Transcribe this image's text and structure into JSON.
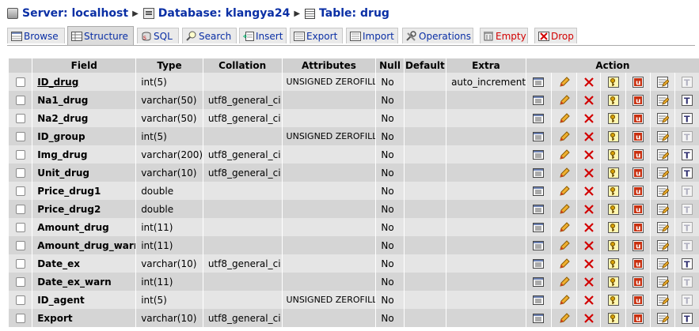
{
  "breadcrumb": {
    "server": "Server: localhost",
    "database": "Database: klangya24",
    "table": "Table: drug"
  },
  "tabs": [
    {
      "label": "Browse",
      "icon": "browse-icon"
    },
    {
      "label": "Structure",
      "icon": "structure-icon"
    },
    {
      "label": "SQL",
      "icon": "sql-icon"
    },
    {
      "label": "Search",
      "icon": "search-icon"
    },
    {
      "label": "Insert",
      "icon": "insert-icon"
    },
    {
      "label": "Export",
      "icon": "export-icon"
    },
    {
      "label": "Import",
      "icon": "import-icon"
    },
    {
      "label": "Operations",
      "icon": "operations-icon"
    },
    {
      "label": "Empty",
      "icon": "empty-icon"
    },
    {
      "label": "Drop",
      "icon": "drop-icon"
    }
  ],
  "active_tab": "Structure",
  "columns": {
    "field": "Field",
    "type": "Type",
    "collation": "Collation",
    "attributes": "Attributes",
    "null": "Null",
    "default": "Default",
    "extra": "Extra",
    "action": "Action"
  },
  "rows": [
    {
      "field": "ID_drug",
      "type": "int(5)",
      "collation": "",
      "attributes": "UNSIGNED ZEROFILL",
      "null": "No",
      "default": "",
      "extra": "auto_increment"
    },
    {
      "field": "Na1_drug",
      "type": "varchar(50)",
      "collation": "utf8_general_ci",
      "attributes": "",
      "null": "No",
      "default": "",
      "extra": ""
    },
    {
      "field": "Na2_drug",
      "type": "varchar(50)",
      "collation": "utf8_general_ci",
      "attributes": "",
      "null": "No",
      "default": "",
      "extra": ""
    },
    {
      "field": "ID_group",
      "type": "int(5)",
      "collation": "",
      "attributes": "UNSIGNED ZEROFILL",
      "null": "No",
      "default": "",
      "extra": ""
    },
    {
      "field": "Img_drug",
      "type": "varchar(200)",
      "collation": "utf8_general_ci",
      "attributes": "",
      "null": "No",
      "default": "",
      "extra": ""
    },
    {
      "field": "Unit_drug",
      "type": "varchar(10)",
      "collation": "utf8_general_ci",
      "attributes": "",
      "null": "No",
      "default": "",
      "extra": ""
    },
    {
      "field": "Price_drug1",
      "type": "double",
      "collation": "",
      "attributes": "",
      "null": "No",
      "default": "",
      "extra": ""
    },
    {
      "field": "Price_drug2",
      "type": "double",
      "collation": "",
      "attributes": "",
      "null": "No",
      "default": "",
      "extra": ""
    },
    {
      "field": "Amount_drug",
      "type": "int(11)",
      "collation": "",
      "attributes": "",
      "null": "No",
      "default": "",
      "extra": ""
    },
    {
      "field": "Amount_drug_warn",
      "type": "int(11)",
      "collation": "",
      "attributes": "",
      "null": "No",
      "default": "",
      "extra": ""
    },
    {
      "field": "Date_ex",
      "type": "varchar(10)",
      "collation": "utf8_general_ci",
      "attributes": "",
      "null": "No",
      "default": "",
      "extra": ""
    },
    {
      "field": "Date_ex_warn",
      "type": "int(11)",
      "collation": "",
      "attributes": "",
      "null": "No",
      "default": "",
      "extra": ""
    },
    {
      "field": "ID_agent",
      "type": "int(5)",
      "collation": "",
      "attributes": "UNSIGNED ZEROFILL",
      "null": "No",
      "default": "",
      "extra": ""
    },
    {
      "field": "Export",
      "type": "varchar(10)",
      "collation": "utf8_general_ci",
      "attributes": "",
      "null": "No",
      "default": "",
      "extra": ""
    }
  ],
  "row_actions": [
    "browse-distinct-icon",
    "edit-icon",
    "drop-icon",
    "primary-key-icon",
    "unique-icon",
    "index-icon",
    "fulltext-icon"
  ],
  "colors": {
    "link": "#0a2fa5",
    "danger": "#d20000",
    "header_bg": "#d0d0d0",
    "row_odd": "#e5e5e5",
    "row_even": "#d5d5d5"
  }
}
